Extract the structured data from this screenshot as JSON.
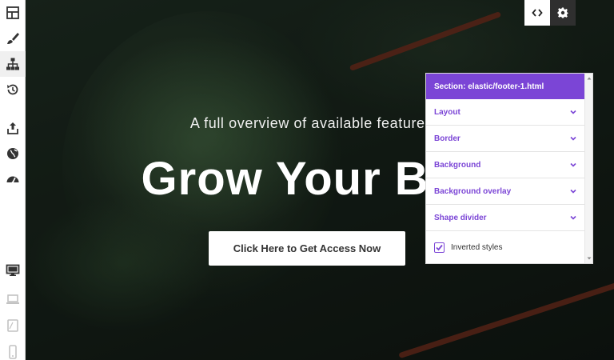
{
  "toolbar": {
    "top_tools": [
      {
        "icon": "layout-icon"
      },
      {
        "icon": "brush-icon"
      },
      {
        "icon": "sitemap-icon"
      },
      {
        "icon": "history-icon"
      },
      {
        "icon": "export-icon"
      },
      {
        "icon": "globe-icon"
      },
      {
        "icon": "dashboard-icon"
      }
    ],
    "device_tools": [
      {
        "icon": "desktop-icon"
      },
      {
        "icon": "laptop-icon"
      },
      {
        "icon": "tablet-icon"
      },
      {
        "icon": "mobile-icon"
      }
    ]
  },
  "hero": {
    "subtitle": "A full overview of available features in",
    "title": "Grow Your Busi",
    "cta_label": "Click Here to Get Access Now"
  },
  "top_controls": {
    "code_icon": "code-icon",
    "settings_icon": "gear-icon"
  },
  "panel": {
    "title": "Section: elastic/footer-1.html",
    "sections": [
      {
        "label": "Layout"
      },
      {
        "label": "Border"
      },
      {
        "label": "Background"
      },
      {
        "label": "Background overlay"
      },
      {
        "label": "Shape divider"
      }
    ],
    "inverted_styles": {
      "label": "Inverted styles",
      "checked": true
    }
  },
  "colors": {
    "accent": "#7b45d6",
    "toolbar_bg": "#ffffff",
    "cta_bg": "#ffffff"
  }
}
